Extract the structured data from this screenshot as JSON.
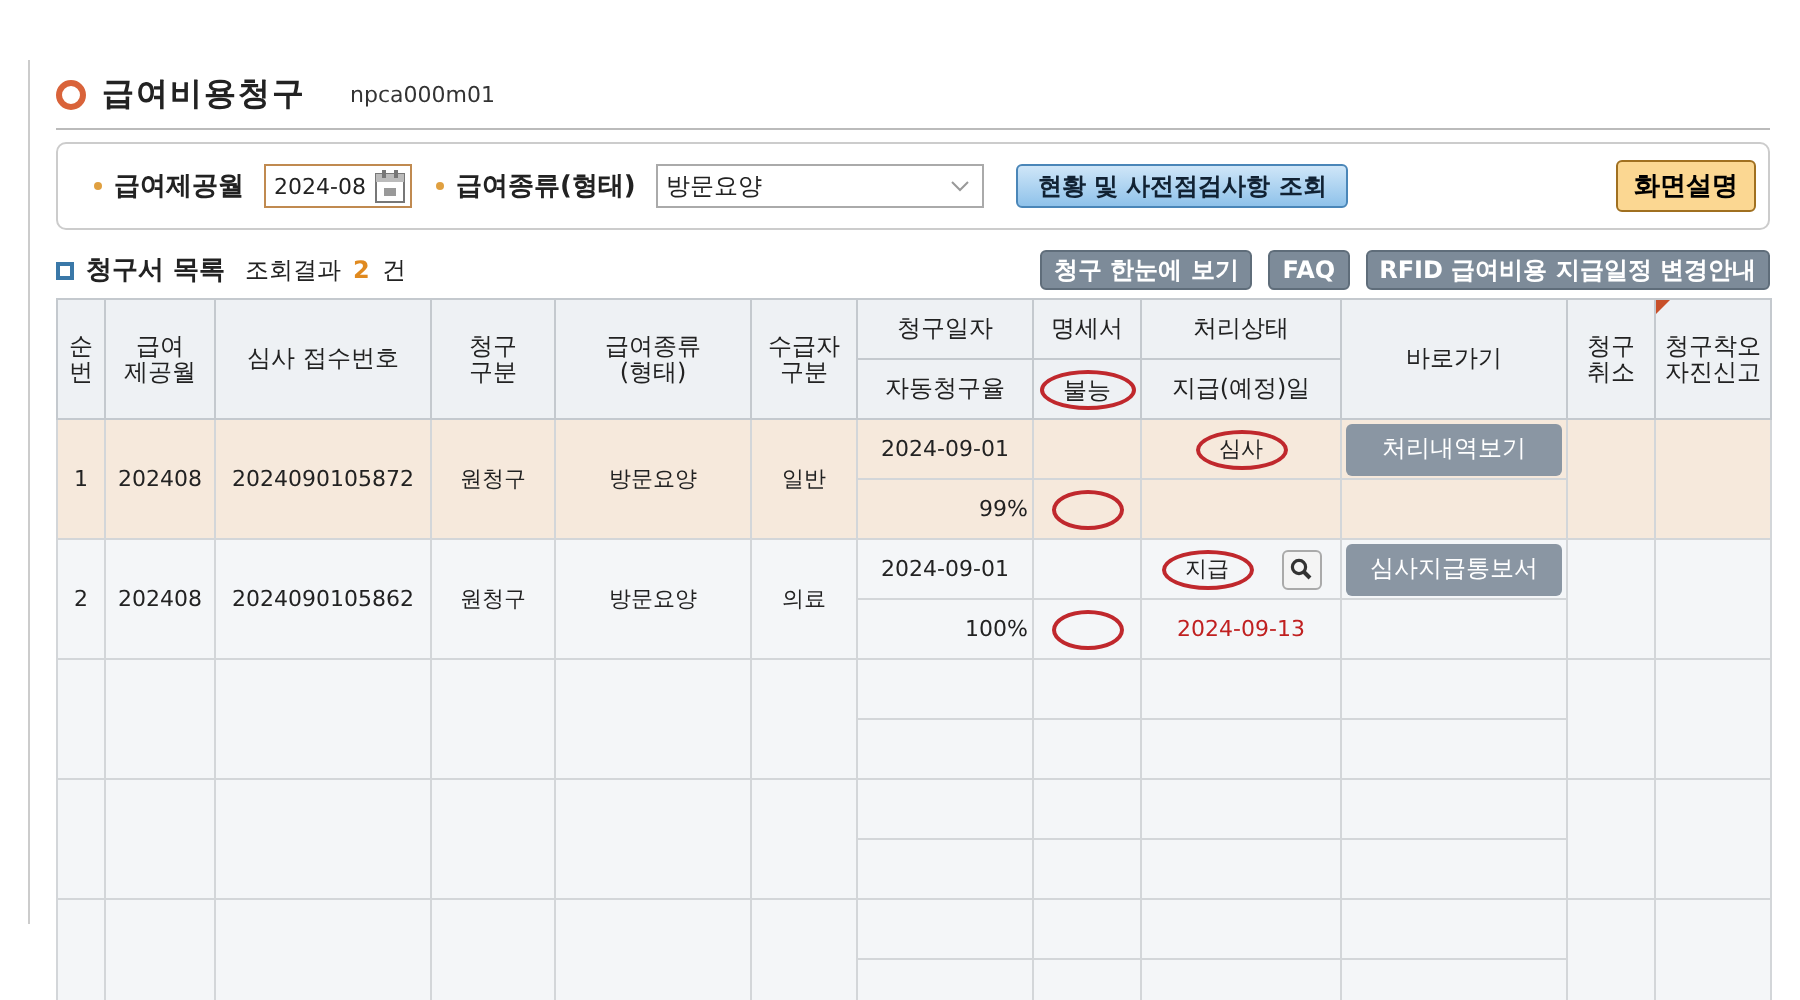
{
  "page": {
    "title": "급여비용청구",
    "code": "npca000m01"
  },
  "search": {
    "fields": [
      {
        "label": "급여제공월",
        "kind": "date",
        "value": "2024-08"
      },
      {
        "label": "급여종류(형태)",
        "kind": "select",
        "value": "방문요양"
      }
    ],
    "query_button": "현황 및 사전점검사항 조회",
    "help_button": "화면설명"
  },
  "list": {
    "title": "청구서 목록",
    "result_label": "조회결과",
    "count": "2",
    "count_unit": "건",
    "buttons": [
      "청구 한눈에 보기",
      "FAQ",
      "RFID 급여비용 지급일정 변경안내"
    ]
  },
  "table": {
    "columns": [
      {
        "label": "순\n번"
      },
      {
        "label": "급여\n제공월"
      },
      {
        "label": "심사 접수번호"
      },
      {
        "label": "청구\n구분"
      },
      {
        "label": "급여종류\n(형태)"
      },
      {
        "label": "수급자\n구분"
      },
      {
        "label": "청구일자",
        "sub": "자동청구율"
      },
      {
        "label": "명세서",
        "sub": "불능",
        "sub_circled": true
      },
      {
        "label": "처리상태",
        "sub": "지급(예정)일"
      },
      {
        "label": "바로가기"
      },
      {
        "label": "청구\n취소"
      },
      {
        "label": "청구착오\n자진신고",
        "flagged": true
      }
    ],
    "rows": [
      {
        "selected": true,
        "cells": [
          "1",
          "202408",
          "2024090105872",
          "원청구",
          "방문요양",
          "일반"
        ],
        "claim_date": "2024-09-01",
        "auto_rate": "99%",
        "statement_circled": true,
        "status": "심사",
        "status_circled": true,
        "detail_icon": false,
        "link": "처리내역보기"
      },
      {
        "selected": false,
        "cells": [
          "2",
          "202408",
          "2024090105862",
          "원청구",
          "방문요양",
          "의료"
        ],
        "claim_date": "2024-09-01",
        "auto_rate": "100%",
        "statement_circled": true,
        "status": "지급",
        "status_circled": true,
        "detail_icon": true,
        "pay_date": "2024-09-13",
        "link": "심사지급통보서"
      }
    ]
  }
}
